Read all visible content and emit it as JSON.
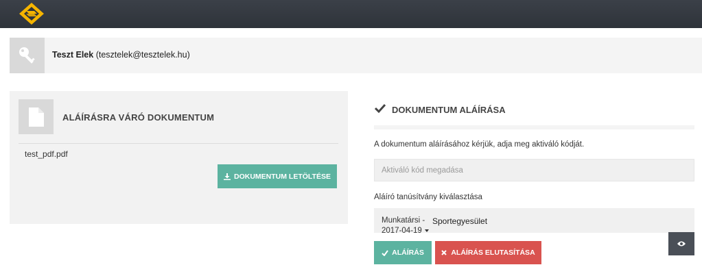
{
  "header": {
    "logo_icon": "diamond-logo-icon"
  },
  "user": {
    "name": "Teszt Elek",
    "email": "(tesztelek@tesztelek.hu)",
    "icon": "key-icon"
  },
  "document_panel": {
    "title": "ALÁÍRÁSRA VÁRÓ DOKUMENTUM",
    "icon": "document-icon",
    "filename": "test_pdf.pdf",
    "download_label": "DOKUMENTUM LETÖLTÉSE"
  },
  "sign_panel": {
    "title": "DOKUMENTUM ALÁÍRÁSA",
    "instructions": "A dokumentum aláírásához kérjük, adja meg aktiváló kódját.",
    "code_placeholder": "Aktiváló kód megadása",
    "cert_label": "Aláíró tanúsítvány kiválasztása",
    "cert_selected_line1": "Munkatársi -",
    "cert_selected_line2": "2017-04-19",
    "cert_selected_org": "Sportegyesület",
    "sign_label": "ALÁÍRÁS",
    "reject_label": "ALÁÍRÁS ELUTASÍTÁSA"
  },
  "colors": {
    "topbar": "#2e333a",
    "accent": "#f5b400",
    "primary": "#5cb3a0",
    "danger": "#d9534f"
  }
}
